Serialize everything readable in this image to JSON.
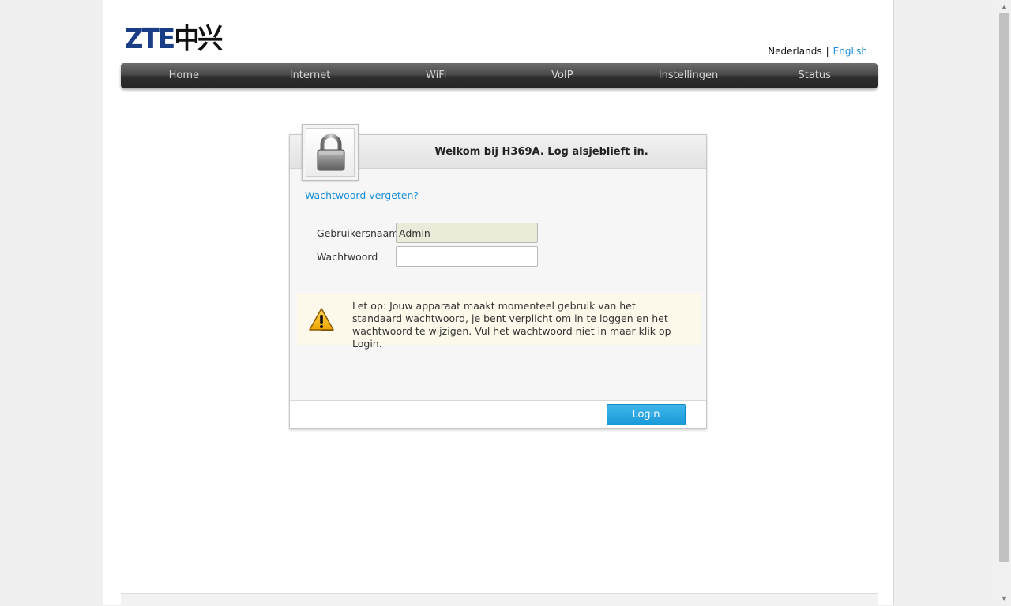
{
  "header": {
    "logo_latin": "ZTE",
    "logo_cjk": "中兴",
    "languages": {
      "dutch": "Nederlands",
      "separator": "|",
      "english": "English"
    }
  },
  "nav": {
    "items": [
      {
        "label": "Home"
      },
      {
        "label": "Internet"
      },
      {
        "label": "WiFi"
      },
      {
        "label": "VoIP"
      },
      {
        "label": "Instellingen"
      },
      {
        "label": "Status"
      }
    ]
  },
  "login": {
    "title": "Welkom bij H369A. Log alsjeblieft in.",
    "forgot_link": "Wachtwoord vergeten?",
    "username_label": "Gebruikersnaam",
    "username_value": "Admin",
    "password_label": "Wachtwoord",
    "password_value": "",
    "notice": "Let op: Jouw apparaat maakt momenteel gebruik van het standaard wachtwoord, je bent verplicht om in te loggen en het wachtwoord te wijzigen. Vul het wachtwoord niet in maar klik op Login.",
    "button_label": "Login"
  },
  "icons": {
    "lock": "padlock-icon",
    "warning": "warning-triangle-icon"
  },
  "colors": {
    "brand_blue": "#1a3e86",
    "link_blue": "#1a8ed8",
    "button_blue": "#1a9ad9",
    "nav_dark": "#2e2e2e",
    "notice_bg": "#fdf9ea",
    "warning_yellow": "#f5b400"
  }
}
